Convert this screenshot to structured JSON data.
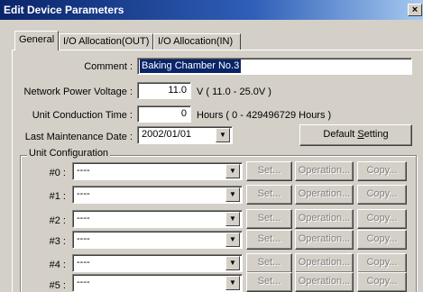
{
  "window": {
    "title": "Edit Device Parameters",
    "close_glyph": "×"
  },
  "tabs": [
    {
      "label": "General",
      "active": true
    },
    {
      "label": "I/O Allocation(OUT)",
      "active": false
    },
    {
      "label": "I/O Allocation(IN)",
      "active": false
    }
  ],
  "general": {
    "comment_label": "Comment :",
    "comment_value": "Baking Chamber No.3",
    "voltage_label": "Network Power Voltage :",
    "voltage_value": "11.0",
    "voltage_hint": "V ( 11.0 - 25.0V )",
    "conduction_label": "Unit Conduction Time :",
    "conduction_value": "0",
    "conduction_hint": "Hours ( 0 - 429496729 Hours )",
    "maintenance_label": "Last Maintenance Date :",
    "maintenance_value": "2002/01/01",
    "default_button_pre": "Default ",
    "default_button_ul": "S",
    "default_button_post": "etting"
  },
  "unit_config": {
    "title": "Unit Configuration",
    "set_label": "Set...",
    "operation_label": "Operation...",
    "copy_label": "Copy...",
    "rows": [
      {
        "label": "#0 :",
        "value": "----"
      },
      {
        "label": "#1 :",
        "value": "----"
      },
      {
        "label": "#2 :",
        "value": "----"
      },
      {
        "label": "#3 :",
        "value": "----"
      },
      {
        "label": "#4 :",
        "value": "----"
      },
      {
        "label": "#5 :",
        "value": "----"
      }
    ]
  },
  "icons": {
    "dropdown": "▼",
    "close": "×"
  }
}
